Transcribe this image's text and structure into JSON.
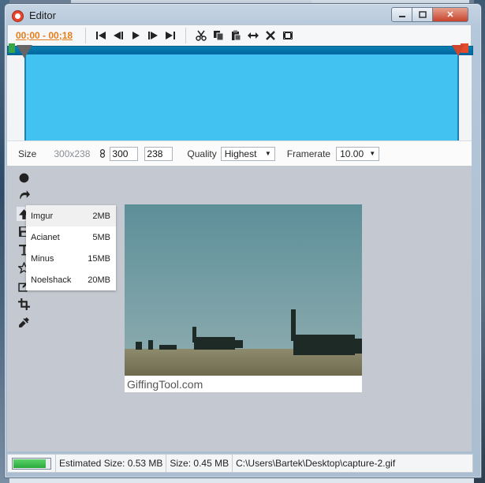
{
  "window": {
    "title": "Editor",
    "controls": [
      "minimize-icon",
      "maximize-icon",
      "close-icon"
    ],
    "close_symbol": "✕"
  },
  "toolbar": {
    "time_range": "00;00 - 00;18",
    "buttons": [
      "first-frame-icon",
      "previous-frame-icon",
      "play-icon",
      "next-frame-icon",
      "last-frame-icon",
      "cut-icon",
      "copy-icon",
      "paste-icon",
      "resize-icon",
      "delete-icon",
      "film-icon"
    ]
  },
  "settings": {
    "size_label": "Size",
    "original_size": "300x238",
    "width": "300",
    "height": "238",
    "quality_label": "Quality",
    "quality_value": "Highest",
    "framerate_label": "Framerate",
    "framerate_value": "10.00"
  },
  "tools": [
    "record-icon",
    "redo-icon",
    "upload-icon",
    "save-icon",
    "text-icon",
    "star-icon",
    "edit-icon",
    "crop-icon",
    "eyedropper-icon"
  ],
  "upload_menu": [
    {
      "name": "Imgur",
      "size": "2MB"
    },
    {
      "name": "Acianet",
      "size": "5MB"
    },
    {
      "name": "Minus",
      "size": "15MB"
    },
    {
      "name": "Noelshack",
      "size": "20MB"
    }
  ],
  "preview": {
    "watermark": "GiffingTool.com"
  },
  "status": {
    "progress": 0.9,
    "estimated_size": "Estimated Size: 0.53 MB",
    "size": "Size: 0.45 MB",
    "path": "C:\\Users\\Bartek\\Desktop\\capture-2.gif"
  },
  "colors": {
    "accent_orange": "#e57c1a",
    "timeline_selection": "#41c2f0",
    "close_red": "#c7432b"
  }
}
